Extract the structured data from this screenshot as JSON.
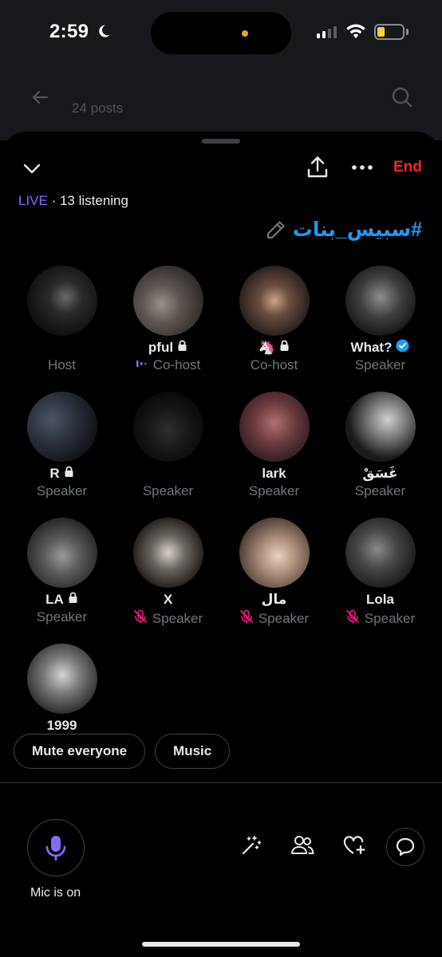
{
  "status_bar": {
    "time": "2:59",
    "icons": [
      "moon-icon",
      "cellular-icon",
      "wifi-icon",
      "battery-low-icon"
    ],
    "battery_color": "#f4d23c"
  },
  "background_header": {
    "posts_count": "24 posts"
  },
  "space": {
    "live_label": "LIVE",
    "listening_text": " · 13 listening",
    "title": "#سبيس_بنات",
    "end_label": "End",
    "end_color": "#f4212e",
    "accent_color": "#1d9bf0",
    "live_color": "#856bff"
  },
  "participants": [
    {
      "name": "",
      "role": "Host",
      "locked": false,
      "verified": false,
      "muted": false,
      "speaking": false,
      "avatar": "guitar-dark"
    },
    {
      "name": "pful",
      "role": "Co-host",
      "locked": true,
      "verified": false,
      "muted": false,
      "speaking": true,
      "avatar": "person-reclining"
    },
    {
      "name": "🦄",
      "role": "Co-host",
      "locked": true,
      "verified": false,
      "muted": false,
      "speaking": false,
      "avatar": "mirror-selfie"
    },
    {
      "name": "What?",
      "role": "Speaker",
      "locked": false,
      "verified": true,
      "muted": false,
      "speaking": false,
      "avatar": "wire-sculpture"
    },
    {
      "name": "R",
      "role": "Speaker",
      "locked": true,
      "verified": false,
      "muted": false,
      "speaking": false,
      "avatar": "dark-room"
    },
    {
      "name": "",
      "role": "Speaker",
      "locked": false,
      "verified": false,
      "muted": false,
      "speaking": false,
      "avatar": "dark-smoke"
    },
    {
      "name": "lark",
      "role": "Speaker",
      "locked": false,
      "verified": false,
      "muted": false,
      "speaking": false,
      "avatar": "face-scarf"
    },
    {
      "name": "غَسَقْ",
      "role": "Speaker",
      "locked": false,
      "verified": false,
      "muted": false,
      "speaking": false,
      "avatar": "crow"
    },
    {
      "name": "LA",
      "role": "Speaker",
      "locked": true,
      "verified": false,
      "muted": false,
      "speaking": false,
      "avatar": "couple-bw"
    },
    {
      "name": "X",
      "role": "Speaker",
      "locked": false,
      "verified": false,
      "muted": true,
      "speaking": false,
      "avatar": "woman-dark-hair"
    },
    {
      "name": "مال",
      "role": "Speaker",
      "locked": false,
      "verified": false,
      "muted": true,
      "speaking": false,
      "avatar": "face-closeup"
    },
    {
      "name": "Lola",
      "role": "Speaker",
      "locked": false,
      "verified": false,
      "muted": true,
      "speaking": false,
      "avatar": "wings"
    },
    {
      "name": "1999",
      "role": "",
      "locked": false,
      "verified": false,
      "muted": false,
      "speaking": false,
      "avatar": "bw-figure"
    }
  ],
  "actions": {
    "mute_everyone": "Mute everyone",
    "music": "Music"
  },
  "bottom_bar": {
    "mic_label": "Mic is on",
    "mic_color": "#856bff",
    "tools": [
      "magic-wand-icon",
      "people-icon",
      "heart-plus-icon",
      "chat-bubble-icon"
    ]
  }
}
